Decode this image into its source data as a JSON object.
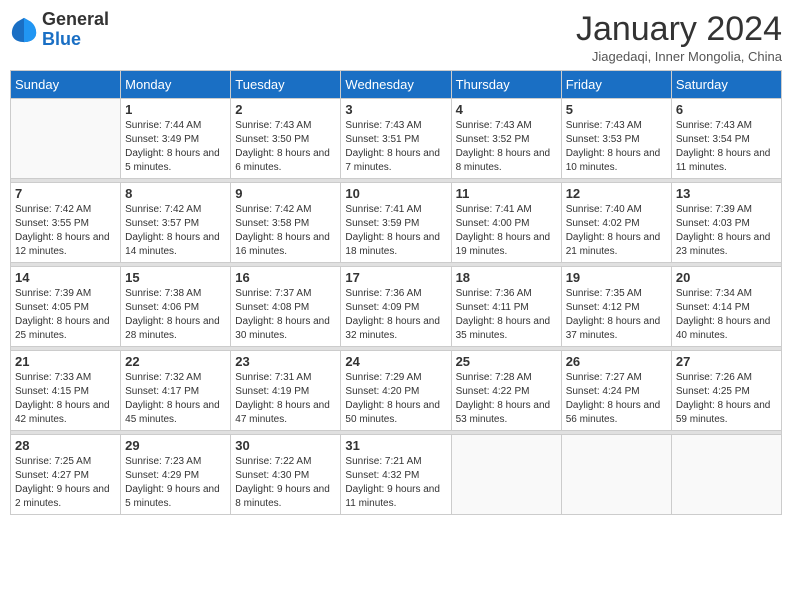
{
  "logo": {
    "general": "General",
    "blue": "Blue"
  },
  "title": "January 2024",
  "location": "Jiagedaqi, Inner Mongolia, China",
  "days_header": [
    "Sunday",
    "Monday",
    "Tuesday",
    "Wednesday",
    "Thursday",
    "Friday",
    "Saturday"
  ],
  "weeks": [
    [
      {
        "day": "",
        "sunrise": "",
        "sunset": "",
        "daylight": ""
      },
      {
        "day": "1",
        "sunrise": "Sunrise: 7:44 AM",
        "sunset": "Sunset: 3:49 PM",
        "daylight": "Daylight: 8 hours and 5 minutes."
      },
      {
        "day": "2",
        "sunrise": "Sunrise: 7:43 AM",
        "sunset": "Sunset: 3:50 PM",
        "daylight": "Daylight: 8 hours and 6 minutes."
      },
      {
        "day": "3",
        "sunrise": "Sunrise: 7:43 AM",
        "sunset": "Sunset: 3:51 PM",
        "daylight": "Daylight: 8 hours and 7 minutes."
      },
      {
        "day": "4",
        "sunrise": "Sunrise: 7:43 AM",
        "sunset": "Sunset: 3:52 PM",
        "daylight": "Daylight: 8 hours and 8 minutes."
      },
      {
        "day": "5",
        "sunrise": "Sunrise: 7:43 AM",
        "sunset": "Sunset: 3:53 PM",
        "daylight": "Daylight: 8 hours and 10 minutes."
      },
      {
        "day": "6",
        "sunrise": "Sunrise: 7:43 AM",
        "sunset": "Sunset: 3:54 PM",
        "daylight": "Daylight: 8 hours and 11 minutes."
      }
    ],
    [
      {
        "day": "7",
        "sunrise": "Sunrise: 7:42 AM",
        "sunset": "Sunset: 3:55 PM",
        "daylight": "Daylight: 8 hours and 12 minutes."
      },
      {
        "day": "8",
        "sunrise": "Sunrise: 7:42 AM",
        "sunset": "Sunset: 3:57 PM",
        "daylight": "Daylight: 8 hours and 14 minutes."
      },
      {
        "day": "9",
        "sunrise": "Sunrise: 7:42 AM",
        "sunset": "Sunset: 3:58 PM",
        "daylight": "Daylight: 8 hours and 16 minutes."
      },
      {
        "day": "10",
        "sunrise": "Sunrise: 7:41 AM",
        "sunset": "Sunset: 3:59 PM",
        "daylight": "Daylight: 8 hours and 18 minutes."
      },
      {
        "day": "11",
        "sunrise": "Sunrise: 7:41 AM",
        "sunset": "Sunset: 4:00 PM",
        "daylight": "Daylight: 8 hours and 19 minutes."
      },
      {
        "day": "12",
        "sunrise": "Sunrise: 7:40 AM",
        "sunset": "Sunset: 4:02 PM",
        "daylight": "Daylight: 8 hours and 21 minutes."
      },
      {
        "day": "13",
        "sunrise": "Sunrise: 7:39 AM",
        "sunset": "Sunset: 4:03 PM",
        "daylight": "Daylight: 8 hours and 23 minutes."
      }
    ],
    [
      {
        "day": "14",
        "sunrise": "Sunrise: 7:39 AM",
        "sunset": "Sunset: 4:05 PM",
        "daylight": "Daylight: 8 hours and 25 minutes."
      },
      {
        "day": "15",
        "sunrise": "Sunrise: 7:38 AM",
        "sunset": "Sunset: 4:06 PM",
        "daylight": "Daylight: 8 hours and 28 minutes."
      },
      {
        "day": "16",
        "sunrise": "Sunrise: 7:37 AM",
        "sunset": "Sunset: 4:08 PM",
        "daylight": "Daylight: 8 hours and 30 minutes."
      },
      {
        "day": "17",
        "sunrise": "Sunrise: 7:36 AM",
        "sunset": "Sunset: 4:09 PM",
        "daylight": "Daylight: 8 hours and 32 minutes."
      },
      {
        "day": "18",
        "sunrise": "Sunrise: 7:36 AM",
        "sunset": "Sunset: 4:11 PM",
        "daylight": "Daylight: 8 hours and 35 minutes."
      },
      {
        "day": "19",
        "sunrise": "Sunrise: 7:35 AM",
        "sunset": "Sunset: 4:12 PM",
        "daylight": "Daylight: 8 hours and 37 minutes."
      },
      {
        "day": "20",
        "sunrise": "Sunrise: 7:34 AM",
        "sunset": "Sunset: 4:14 PM",
        "daylight": "Daylight: 8 hours and 40 minutes."
      }
    ],
    [
      {
        "day": "21",
        "sunrise": "Sunrise: 7:33 AM",
        "sunset": "Sunset: 4:15 PM",
        "daylight": "Daylight: 8 hours and 42 minutes."
      },
      {
        "day": "22",
        "sunrise": "Sunrise: 7:32 AM",
        "sunset": "Sunset: 4:17 PM",
        "daylight": "Daylight: 8 hours and 45 minutes."
      },
      {
        "day": "23",
        "sunrise": "Sunrise: 7:31 AM",
        "sunset": "Sunset: 4:19 PM",
        "daylight": "Daylight: 8 hours and 47 minutes."
      },
      {
        "day": "24",
        "sunrise": "Sunrise: 7:29 AM",
        "sunset": "Sunset: 4:20 PM",
        "daylight": "Daylight: 8 hours and 50 minutes."
      },
      {
        "day": "25",
        "sunrise": "Sunrise: 7:28 AM",
        "sunset": "Sunset: 4:22 PM",
        "daylight": "Daylight: 8 hours and 53 minutes."
      },
      {
        "day": "26",
        "sunrise": "Sunrise: 7:27 AM",
        "sunset": "Sunset: 4:24 PM",
        "daylight": "Daylight: 8 hours and 56 minutes."
      },
      {
        "day": "27",
        "sunrise": "Sunrise: 7:26 AM",
        "sunset": "Sunset: 4:25 PM",
        "daylight": "Daylight: 8 hours and 59 minutes."
      }
    ],
    [
      {
        "day": "28",
        "sunrise": "Sunrise: 7:25 AM",
        "sunset": "Sunset: 4:27 PM",
        "daylight": "Daylight: 9 hours and 2 minutes."
      },
      {
        "day": "29",
        "sunrise": "Sunrise: 7:23 AM",
        "sunset": "Sunset: 4:29 PM",
        "daylight": "Daylight: 9 hours and 5 minutes."
      },
      {
        "day": "30",
        "sunrise": "Sunrise: 7:22 AM",
        "sunset": "Sunset: 4:30 PM",
        "daylight": "Daylight: 9 hours and 8 minutes."
      },
      {
        "day": "31",
        "sunrise": "Sunrise: 7:21 AM",
        "sunset": "Sunset: 4:32 PM",
        "daylight": "Daylight: 9 hours and 11 minutes."
      },
      {
        "day": "",
        "sunrise": "",
        "sunset": "",
        "daylight": ""
      },
      {
        "day": "",
        "sunrise": "",
        "sunset": "",
        "daylight": ""
      },
      {
        "day": "",
        "sunrise": "",
        "sunset": "",
        "daylight": ""
      }
    ]
  ]
}
